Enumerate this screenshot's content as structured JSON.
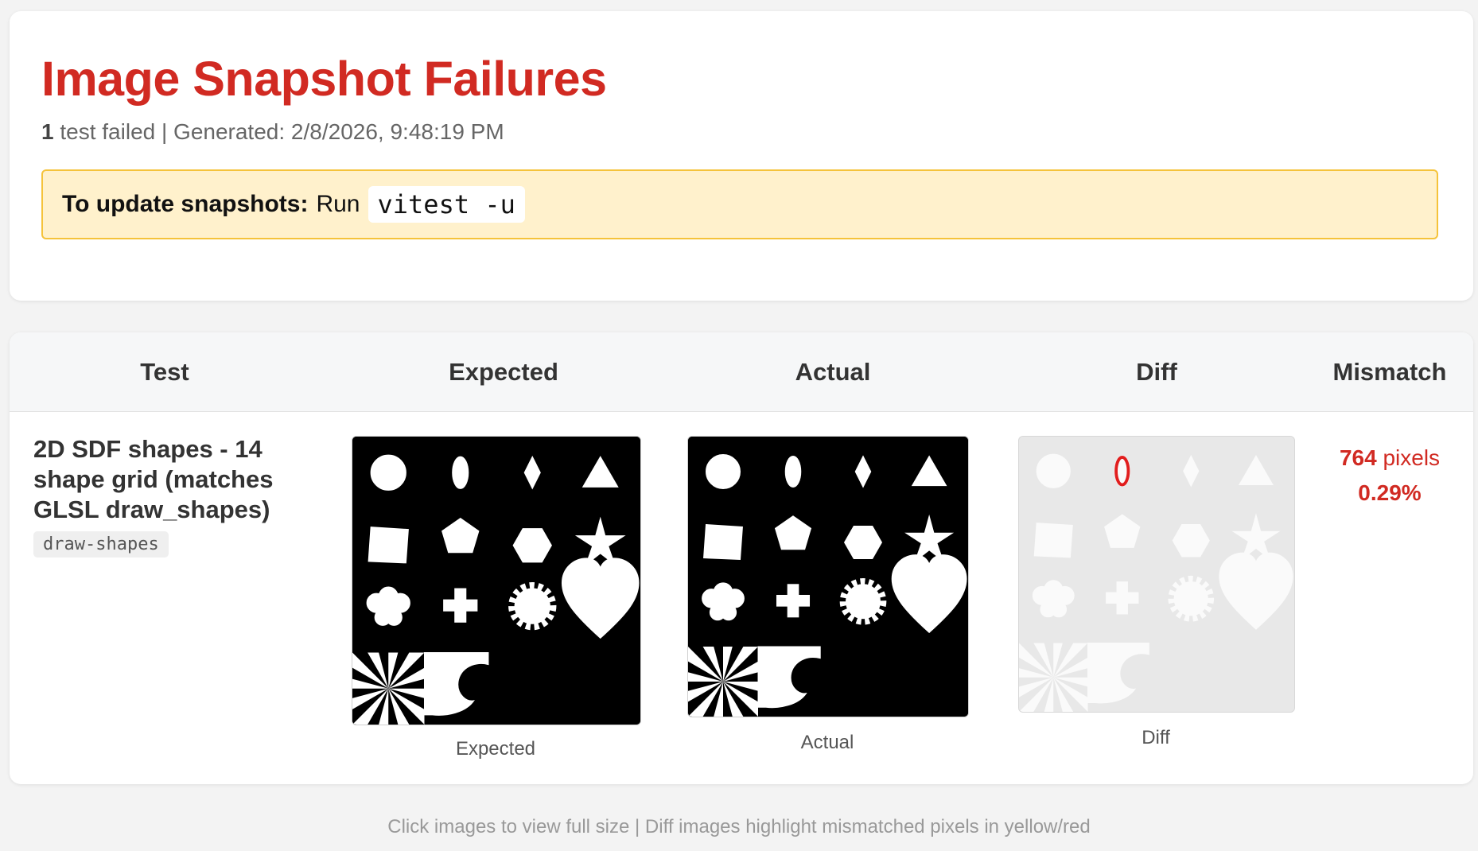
{
  "header": {
    "title": "Image Snapshot Failures",
    "failed_count": "1",
    "failed_text": "test failed | Generated: 2/8/2026, 9:48:19 PM",
    "notice_label": "To update snapshots:",
    "notice_run": "Run",
    "notice_command": "vitest -u"
  },
  "table": {
    "columns": [
      "Test",
      "Expected",
      "Actual",
      "Diff",
      "Mismatch"
    ],
    "rows": [
      {
        "test_name": "2D SDF shapes - 14 shape grid (matches GLSL draw_shapes)",
        "test_id": "draw-shapes",
        "expected_caption": "Expected",
        "actual_caption": "Actual",
        "diff_caption": "Diff",
        "mismatch_pixels": "764",
        "mismatch_unit": "pixels",
        "mismatch_percent": "0.29%"
      }
    ]
  },
  "colors": {
    "title": "#d12a22",
    "notice_bg": "#fff1cc",
    "notice_border": "#f5c33b",
    "diff_highlight": "#e11d1d"
  },
  "footer": "Click images to view full size | Diff images highlight mismatched pixels in yellow/red"
}
